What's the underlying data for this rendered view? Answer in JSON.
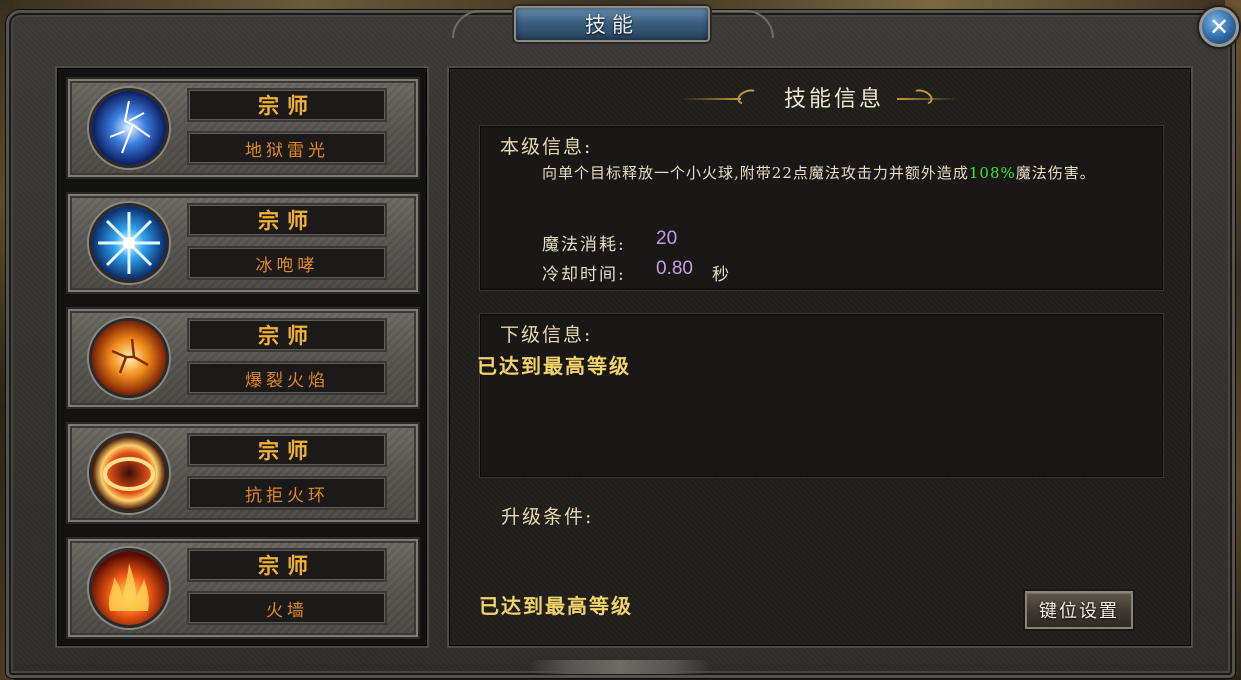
{
  "window": {
    "title": "技能",
    "close_icon": "✕"
  },
  "skills": [
    {
      "level": "宗师",
      "name": "地狱雷光",
      "icon": "lightning-orb-icon",
      "palette": [
        "#dff2ff",
        "#3b7de0",
        "#0b1c5e"
      ]
    },
    {
      "level": "宗师",
      "name": "冰咆哮",
      "icon": "ice-burst-icon",
      "palette": [
        "#ffffff",
        "#2fa4f0",
        "#0a2a66"
      ]
    },
    {
      "level": "宗师",
      "name": "爆裂火焰",
      "icon": "fire-explosion-icon",
      "palette": [
        "#fff4b0",
        "#f08a1a",
        "#7a1f05"
      ]
    },
    {
      "level": "宗师",
      "name": "抗拒火环",
      "icon": "fire-ring-icon",
      "palette": [
        "#ffd26a",
        "#e0501a",
        "#3a0e05"
      ]
    },
    {
      "level": "宗师",
      "name": "火墙",
      "icon": "fire-wall-icon",
      "palette": [
        "#ffe27a",
        "#f05a14",
        "#5a0c04"
      ]
    }
  ],
  "info": {
    "header": "技能信息",
    "current": {
      "label": "本级信息:",
      "desc_before": "向单个目标释放一个小火球,附带22点魔法攻击力并额外造成",
      "desc_highlight": "108%",
      "desc_after": "魔法伤害。",
      "mana_label": "魔法消耗:",
      "mana_value": "20",
      "cooldown_label": "冷却时间:",
      "cooldown_value": "0.80",
      "cooldown_unit": "秒"
    },
    "next": {
      "label": "下级信息:",
      "text": "已达到最高等级"
    },
    "upgrade": {
      "label": "升级条件:",
      "text": "已达到最高等级"
    },
    "keybind_button": "键位设置"
  },
  "colors": {
    "accent_gold": "#f2b233",
    "skill_name_orange": "#e0872a",
    "highlight_green": "#3de03d",
    "stat_purple": "#c79be8",
    "title_blue": "#3b5f80"
  }
}
